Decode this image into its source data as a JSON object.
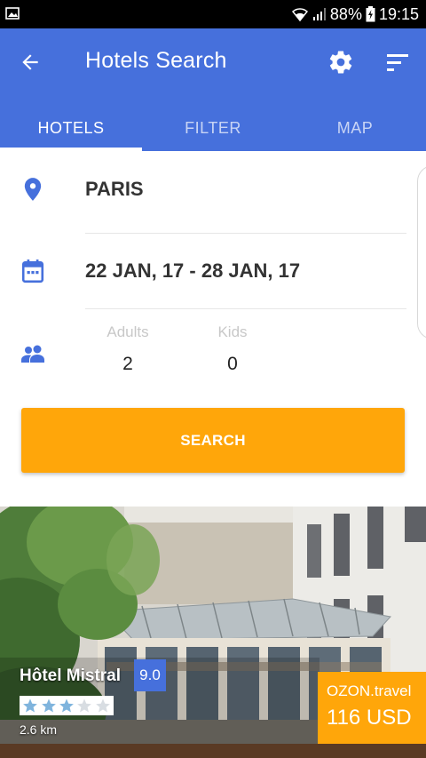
{
  "status_bar": {
    "battery": "88%",
    "time": "19:15"
  },
  "app_bar": {
    "title": "Hotels Search",
    "back_icon": "arrow-back-icon",
    "settings_icon": "gear-icon",
    "sort_icon": "sort-icon",
    "color": "#4670dc"
  },
  "tabs": [
    {
      "label": "HOTELS",
      "active": true
    },
    {
      "label": "FILTER",
      "active": false
    },
    {
      "label": "MAP",
      "active": false
    }
  ],
  "search_form": {
    "city": "PARIS",
    "dates": "22 JAN, 17 - 28 JAN, 17",
    "guests": {
      "adults_label": "Adults",
      "adults_value": "2",
      "kids_label": "Kids",
      "kids_value": "0"
    },
    "search_button": "SEARCH",
    "accent_color": "#ffa60a"
  },
  "hotel_card": {
    "name": "Hôtel Mistral",
    "rating": "9.0",
    "stars": 3,
    "max_stars": 5,
    "distance": "2.6 km",
    "provider": "OZON.travel",
    "price": "116 USD"
  }
}
